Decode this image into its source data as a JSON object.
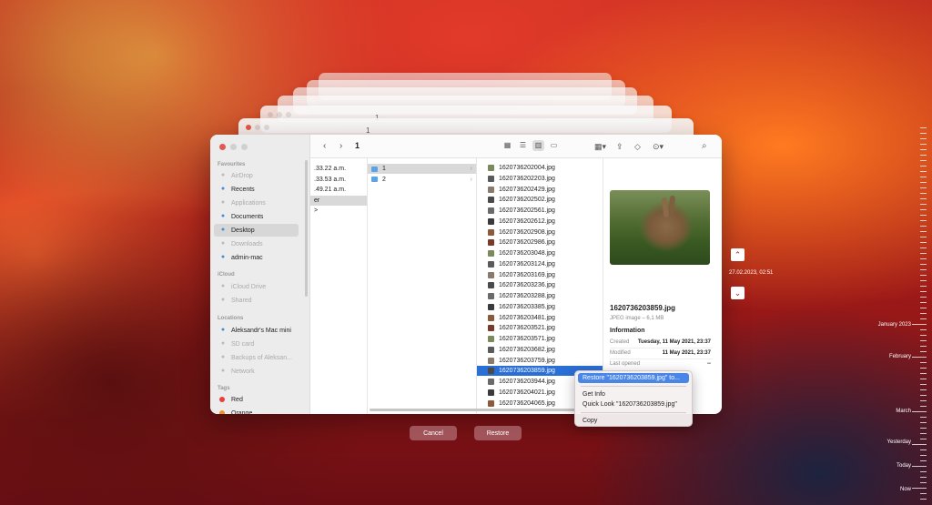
{
  "ghost_windows": [
    {
      "title": "1"
    },
    {
      "title": "1"
    },
    {
      "title": "1"
    }
  ],
  "toolbar": {
    "back": "‹",
    "forward": "›",
    "title": "1",
    "search": "⌕"
  },
  "sidebar": {
    "favourites_heading": "Favourites",
    "favourites": [
      {
        "label": "AirDrop",
        "icon": "airdrop-icon",
        "dim": true
      },
      {
        "label": "Recents",
        "icon": "clock-icon",
        "dim": false
      },
      {
        "label": "Applications",
        "icon": "applications-icon",
        "dim": true
      },
      {
        "label": "Documents",
        "icon": "document-icon",
        "dim": false
      },
      {
        "label": "Desktop",
        "icon": "desktop-icon",
        "dim": false,
        "active": true
      },
      {
        "label": "Downloads",
        "icon": "download-icon",
        "dim": true
      },
      {
        "label": "admin-mac",
        "icon": "home-icon",
        "dim": false
      }
    ],
    "icloud_heading": "iCloud",
    "icloud": [
      {
        "label": "iCloud Drive",
        "icon": "cloud-icon",
        "dim": true
      },
      {
        "label": "Shared",
        "icon": "shared-folder-icon",
        "dim": true
      }
    ],
    "locations_heading": "Locations",
    "locations": [
      {
        "label": "Aleksandr's Mac mini",
        "icon": "computer-icon",
        "dim": false
      },
      {
        "label": "SD card",
        "icon": "drive-icon",
        "dim": true
      },
      {
        "label": "Backups of Aleksan...",
        "icon": "backup-drive-icon",
        "dim": true
      },
      {
        "label": "Network",
        "icon": "network-icon",
        "dim": true
      }
    ],
    "tags_heading": "Tags",
    "tags": [
      {
        "label": "Red",
        "color": "#e8403a"
      },
      {
        "label": "Orange",
        "color": "#f0902a"
      }
    ]
  },
  "column1": [
    ".33.22 a.m.",
    ".33.53 a.m.",
    ".49.21 a.m.",
    "er",
    ">"
  ],
  "column2": [
    {
      "label": "1",
      "selected": true
    },
    {
      "label": "2",
      "selected": false
    }
  ],
  "files": [
    "1620736202004.jpg",
    "1620736202203.jpg",
    "1620736202429.jpg",
    "1620736202502.jpg",
    "1620736202561.jpg",
    "1620736202612.jpg",
    "1620736202908.jpg",
    "1620736202986.jpg",
    "1620736203048.jpg",
    "1620736203124.jpg",
    "1620736203169.jpg",
    "1620736203236.jpg",
    "1620736203288.jpg",
    "1620736203385.jpg",
    "1620736203481.jpg",
    "1620736203521.jpg",
    "1620736203571.jpg",
    "1620736203682.jpg",
    "1620736203759.jpg",
    "1620736203859.jpg",
    "1620736203944.jpg",
    "1620736204021.jpg",
    "1620736204065.jpg"
  ],
  "selected_file_index": 19,
  "preview": {
    "filename": "1620736203859.jpg",
    "kind": "JPEG image – 6,1 MB",
    "info_heading": "Information",
    "created_label": "Created",
    "created_value": "Tuesday, 11 May 2021, 23:37",
    "modified_label": "Modified",
    "modified_value": "11 May 2021, 23:37",
    "last_opened_label": "Last opened",
    "last_opened_value": "--"
  },
  "context_menu": {
    "restore": "Restore \"1620736203859.jpg\" to...",
    "get_info": "Get Info",
    "quick_look": "Quick Look \"1620736203859.jpg\"",
    "copy": "Copy"
  },
  "buttons": {
    "cancel": "Cancel",
    "restore": "Restore"
  },
  "time_machine": {
    "up": "⌃",
    "down": "⌄",
    "current_snapshot": "27.02.2023, 02:51",
    "timeline": [
      "January 2023",
      "February",
      "March",
      "Yesterday",
      "Today",
      "Now"
    ]
  }
}
